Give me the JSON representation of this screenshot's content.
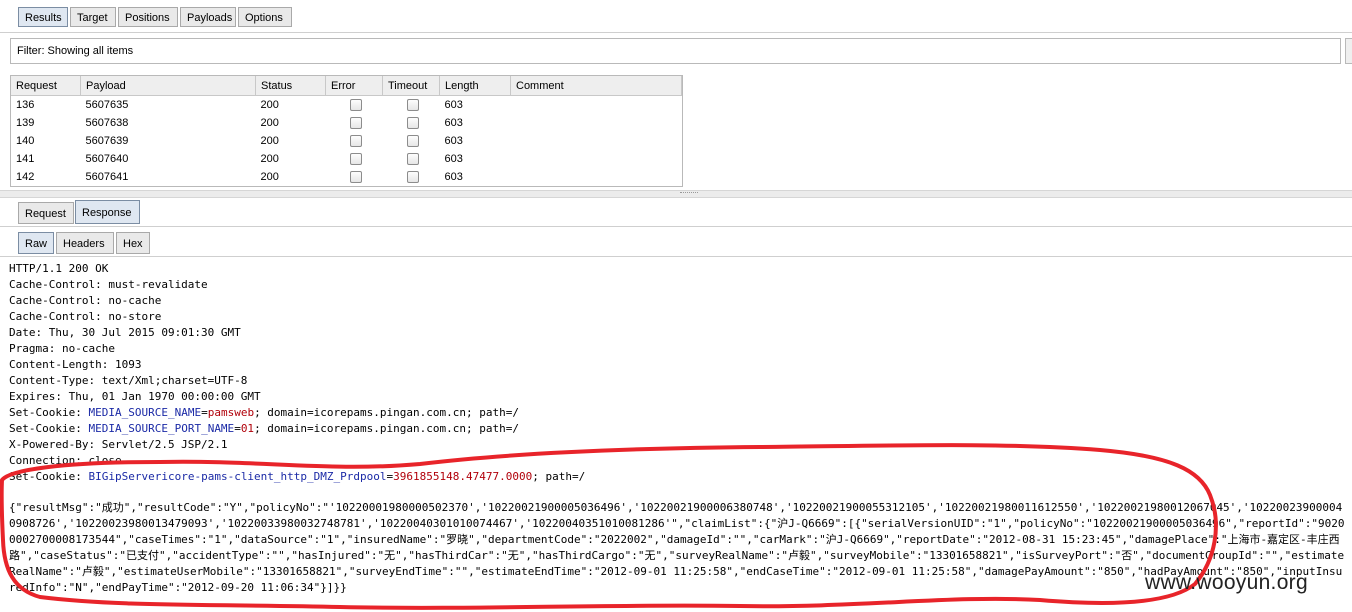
{
  "top_tabs": [
    "Results",
    "Target",
    "Positions",
    "Payloads",
    "Options"
  ],
  "filter": {
    "label": "Filter: Showing all items"
  },
  "table": {
    "columns": [
      "Request",
      "Payload",
      "Status",
      "Error",
      "Timeout",
      "Length",
      "Comment"
    ],
    "rows": [
      {
        "request": "136",
        "payload": "5607635",
        "status": "200",
        "length": "603"
      },
      {
        "request": "139",
        "payload": "5607638",
        "status": "200",
        "length": "603"
      },
      {
        "request": "140",
        "payload": "5607639",
        "status": "200",
        "length": "603"
      },
      {
        "request": "141",
        "payload": "5607640",
        "status": "200",
        "length": "603"
      },
      {
        "request": "142",
        "payload": "5607641",
        "status": "200",
        "length": "603"
      }
    ]
  },
  "rr_tabs": [
    "Request",
    "Response"
  ],
  "view_tabs": [
    "Raw",
    "Headers",
    "Hex"
  ],
  "response": {
    "status_line": "HTTP/1.1 200 OK",
    "headers": [
      "Cache-Control: must-revalidate",
      "Cache-Control: no-cache",
      "Cache-Control: no-store",
      "Date: Thu, 30 Jul 2015 09:01:30 GMT",
      "Pragma: no-cache",
      "Content-Length: 1093",
      "Content-Type: text/Xml;charset=UTF-8",
      "Expires: Thu, 01 Jan 1970 00:00:00 GMT"
    ],
    "cookies": [
      {
        "prefix": "Set-Cookie: ",
        "name": "MEDIA_SOURCE_NAME",
        "eq": "=",
        "value": "pamsweb",
        "suffix": "; domain=icorepams.pingan.com.cn; path=/"
      },
      {
        "prefix": "Set-Cookie: ",
        "name": "MEDIA_SOURCE_PORT_NAME",
        "eq": "=",
        "value": "01",
        "suffix": "; domain=icorepams.pingan.com.cn; path=/"
      }
    ],
    "headers2": [
      "X-Powered-By: Servlet/2.5 JSP/2.1",
      "Connection: close"
    ],
    "cookie3": {
      "prefix": "Set-Cookie: ",
      "name": "BIGipServericore-",
      "mid": "pams-client_http_DMZ_Prdpool",
      "eq": "=",
      "value": "3961855148.47477.0000",
      "suffix": "; path=/"
    },
    "json_body": "{\"resultMsg\":\"成功\",\"resultCode\":\"Y\",\"policyNo\":\"'10220001980000502370','10220021900005036496','10220021900006380748','10220021900055312105','10220021980011612550','10220021980012067045','1022002390000409087​26','10220023980013479093','10220033980032748781','10220040301010074467','10220040351010081286'\",\"claimList\":{\"沪J-Q6669\":[{\"serialVersionUID\":\"1\",\"policyNo\":\"10220021900005036496\",\"reportId\":\"90200002700008173544\",\"caseTimes\":\"1\",\"dataSource\":\"1\",\"insuredName\":\"罗晓\",\"departmentCode\":\"2022002\",\"damageId\":\"\",\"carMark\":\"沪J-Q6669\",\"reportDate\":\"2012-08-31 15:23:45\",\"damagePlace\":\"上海市-嘉定区-丰庄西路\",\"caseStatus\":\"已支付\",\"accidentType\":\"\",\"hasInjured\":\"无\",\"hasThirdCar\":\"无\",\"hasThirdCargo\":\"无\",\"surveyRealName\":\"卢毅\",\"surveyMobile\":\"13301658821\",\"isSurveyPort\":\"否\",\"documentGroupId\":\"\",\"estimateRealName\":\"卢毅\",\"estimateUserMobile\":\"13301658821\",\"surveyEndTime\":\"\",\"estimateEndTime\":\"2012-09-01 11:25:58\",\"endCaseTime\":\"2012-09-01 11:25:58\",\"damagePayAmount\":\"850\",\"hadPayAmount\":\"850\",\"inputInsuredInfo\":\"N\",\"endPayTime\":\"2012-09-20 11:06:34\"}]}}"
  },
  "watermark": "www.wooyun.org",
  "colors": {
    "annotation": "#e8242a",
    "cookie_name": "#1b2aa6",
    "cookie_value": "#b1000a"
  }
}
